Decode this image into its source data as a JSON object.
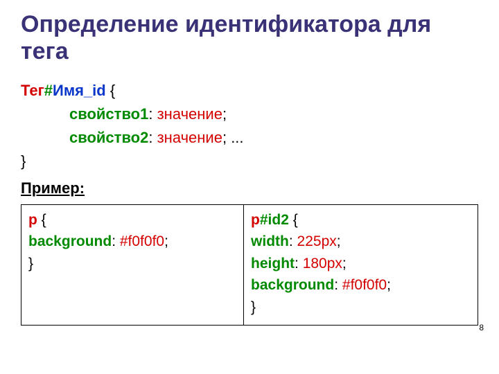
{
  "title": "Определение идентификатора для тега",
  "syntax": {
    "line1": {
      "tag": "Тег",
      "hash": "#",
      "name": "Имя_id",
      "brace": " {"
    },
    "line2": {
      "prop": "свойство1",
      "colon": ": ",
      "val": "значение",
      "semi": ";"
    },
    "line3": {
      "prop": "свойство2",
      "colon": ": ",
      "val": "значение",
      "semi": "; ",
      "ell": "..."
    },
    "line4": "}",
    "example_label": "Пример:"
  },
  "table": {
    "left": {
      "l1": {
        "sel": "p",
        "brace": " {"
      },
      "l2": {
        "prop": "background",
        "colon": ": ",
        "val": "#f0f0f0",
        "semi": ";"
      },
      "l3": "}"
    },
    "right": {
      "l1": {
        "sel": "p",
        "id": "#id2",
        "brace": " {"
      },
      "l2": {
        "prop": "width",
        "colon": ": ",
        "val": "225px",
        "semi": ";"
      },
      "l3": {
        "prop": "height",
        "colon": ": ",
        "val": "180px",
        "semi": ";"
      },
      "l4": {
        "prop": "background",
        "colon": ": ",
        "val": "#f0f0f0",
        "semi": ";"
      },
      "l5": "}"
    }
  },
  "page_number": "8"
}
